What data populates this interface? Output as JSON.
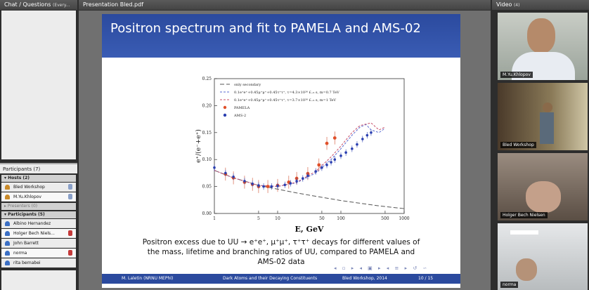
{
  "chat": {
    "title": "Chat / Questions",
    "subtitle": "(Every..."
  },
  "participants": {
    "header": "Participants",
    "count": "(7)",
    "hosts_label": "Hosts (2)",
    "presenters_label": "Presenters (0)",
    "participants_label": "Participants (5)",
    "hosts": [
      "Bled Workshop",
      "M.Yu.Khlopov"
    ],
    "members": [
      "Albino Hernandez",
      "Holger Bech Niels...",
      "John Barrett",
      "norma",
      "rita bernabei"
    ]
  },
  "presentation": {
    "title": "Presentation Bled.pdf"
  },
  "slide": {
    "title": "Positron spectrum and fit to PAMELA and AMS-02",
    "caption_line1": "Positron excess due to UU → e⁺e⁺, μ⁺μ⁺, τ⁺τ⁺ decays for different values of",
    "caption_line2": "the mass, lifetime and branching ratios of UU, compared to PAMELA and",
    "caption_line3": "AMS-02 data",
    "footer_author": "M. Laletin  (NRNU MEPhI)",
    "footer_talk": "Dark Atoms and their Decaying Constituents",
    "footer_event": "Bled Workshop, 2014",
    "footer_page": "10 / 15",
    "nav_symbols": "◂ ▫ ▸ ◂ ▣ ▸ ◂ ≡ ▸ ↺ ∽"
  },
  "video": {
    "title": "Video",
    "count": "(4)",
    "tiles": [
      "M.Yu.Khlopov",
      "Bled Workshop",
      "Holger Bech Nielsen",
      "norma"
    ]
  },
  "chart_data": {
    "type": "scatter",
    "xlabel": "E, GeV",
    "ylabel": "e⁺/(e⁻+e⁺)",
    "xscale": "log",
    "xlim": [
      1,
      1000
    ],
    "ylim": [
      0,
      0.25
    ],
    "x_ticks": [
      "1",
      "5",
      "10",
      "50",
      "100",
      "500",
      "1000"
    ],
    "y_ticks": [
      "0.00",
      "0.05",
      "0.10",
      "0.15",
      "0.20",
      "0.25"
    ],
    "legend_placement": "top-left",
    "series": [
      {
        "name": "only secondary",
        "style": "dashed-black",
        "x": [
          1,
          2,
          3,
          5,
          10,
          20,
          50,
          100,
          200,
          400,
          700,
          1000
        ],
        "y": [
          0.08,
          0.066,
          0.06,
          0.052,
          0.045,
          0.038,
          0.03,
          0.024,
          0.019,
          0.014,
          0.011,
          0.009
        ]
      },
      {
        "name": "0.1e⁺e⁺+0.45μ⁺μ⁺+0.45τ⁺τ⁺, τ=4.3×10²⁶ £₋₆ s, m=0.7 TeV",
        "style": "dashed-blue",
        "x": [
          1,
          2,
          3,
          5,
          10,
          20,
          40,
          70,
          100,
          150,
          200,
          250,
          300,
          400,
          500
        ],
        "y": [
          0.08,
          0.066,
          0.06,
          0.052,
          0.05,
          0.057,
          0.075,
          0.1,
          0.12,
          0.145,
          0.16,
          0.165,
          0.155,
          0.15,
          0.158
        ]
      },
      {
        "name": "0.1e⁺e⁺+0.45μ⁺μ⁺+0.45τ⁺τ⁺, τ=3.7×10²⁶ £₋₆ s, m=1 TeV",
        "style": "dashed-red",
        "x": [
          1,
          2,
          3,
          5,
          10,
          20,
          40,
          70,
          100,
          150,
          200,
          300,
          400,
          500
        ],
        "y": [
          0.08,
          0.066,
          0.06,
          0.052,
          0.05,
          0.058,
          0.078,
          0.105,
          0.125,
          0.15,
          0.163,
          0.168,
          0.155,
          0.16
        ]
      },
      {
        "name": "PAMELA",
        "style": "red-dots",
        "x": [
          1.5,
          2,
          3,
          4,
          5,
          7,
          10,
          15,
          20,
          30,
          45,
          60,
          80
        ],
        "y": [
          0.073,
          0.066,
          0.058,
          0.054,
          0.05,
          0.05,
          0.052,
          0.058,
          0.065,
          0.074,
          0.09,
          0.13,
          0.14
        ]
      },
      {
        "name": "AMS-2",
        "style": "blue-points",
        "x": [
          1,
          1.5,
          2,
          3,
          4,
          5,
          6,
          8,
          10,
          13,
          16,
          20,
          25,
          30,
          40,
          50,
          60,
          70,
          80,
          100,
          120,
          150,
          180,
          220,
          260,
          300
        ],
        "y": [
          0.085,
          0.075,
          0.068,
          0.06,
          0.055,
          0.052,
          0.05,
          0.05,
          0.051,
          0.053,
          0.056,
          0.06,
          0.065,
          0.07,
          0.078,
          0.085,
          0.09,
          0.095,
          0.1,
          0.107,
          0.113,
          0.12,
          0.128,
          0.138,
          0.145,
          0.15
        ]
      }
    ]
  }
}
